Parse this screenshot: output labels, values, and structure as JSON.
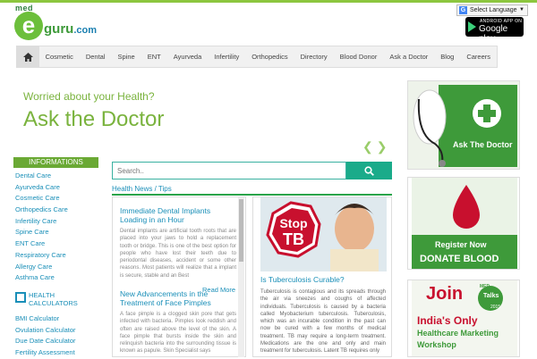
{
  "logo": {
    "med": "med",
    "e": "e",
    "brand": "guru",
    "tld": ".com"
  },
  "language": {
    "label": "Select Language"
  },
  "store_badge": {
    "line1": "ANDROID APP ON",
    "line2": "Google play"
  },
  "nav": {
    "items": [
      "Cosmetic",
      "Dental",
      "Spine",
      "ENT",
      "Ayurveda",
      "Infertility",
      "Orthopedics",
      "Directory",
      "Blood Donor",
      "Ask a Doctor",
      "Blog",
      "Careers"
    ]
  },
  "hero": {
    "subtitle": "Worried about your Health?",
    "title": "Ask the Doctor"
  },
  "sidebar": {
    "heading": "INFORMATIONS",
    "items": [
      "Dental Care",
      "Ayurveda Care",
      "Cosmetic Care",
      "Orthopedics Care",
      "Infertility Care",
      "Spine Care",
      "ENT Care",
      "Respiratory Care",
      "Allergy Care",
      "Asthma Care"
    ],
    "calculators_label_1": "HEALTH",
    "calculators_label_2": "CALCULATORS",
    "calculators": [
      "BMI Calculator",
      "Ovulation Calculator",
      "Due Date Calculator",
      "Fertility Assessment"
    ]
  },
  "search": {
    "placeholder": "Search.."
  },
  "news": {
    "heading": "Health News / Tips",
    "articles": [
      {
        "title": "Immediate Dental Implants Loading in an Hour",
        "body": "Dental implants are artificial tooth roots that are placed into your jaws to hold a replacement tooth or bridge. This is one of the best option for people who have lost their teeth due to periodontal diseases, accident or some other reasons. Most patients will realize that a implant is secure, stable and an Best",
        "read_more": "Read More"
      },
      {
        "title": "New Advancements in the Treatment of Face Pimples",
        "body": "A face pimple is a clogged skin pore that gets infected with bacteria. Pimples look reddish and often are raised above the level of the skin. A face pimple that bursts inside the skin and relinquish bacteria into the surrounding tissue is known as papule. Skin Specialist says"
      }
    ]
  },
  "feature": {
    "sign_text_1": "Stop",
    "sign_text_2": "TB",
    "title": "Is Tuberculosis Curable?",
    "body": "Tuberculosis is contagious and its spreads through the air via sneezes and coughs of affected individuals. Tuberculosis is caused by a bacteria called Myobacterium tuberculosis. Tuberculosis, which was an incurable condition in the past can now be cured with a few months of medical treatment. TB may require a long-term treatment. Medications are the one and only and main treatment for tuberculosis. Latent TB requires only"
  },
  "ads": {
    "ask_doctor": "Ask The Doctor",
    "register_now": "Register Now",
    "donate_blood": "DONATE BLOOD",
    "etalks_join": "Join",
    "etalks_med": "MED",
    "etalks_name": "Talks",
    "etalks_year": "2015",
    "etalks_line1": "India's Only",
    "etalks_line2": "Healthcare Marketing",
    "etalks_line3": "Workshop"
  },
  "colors": {
    "brand_green": "#7ab33e",
    "link_blue": "#1a8fb8",
    "teal": "#1aab8a",
    "blood_red": "#c8102e"
  }
}
